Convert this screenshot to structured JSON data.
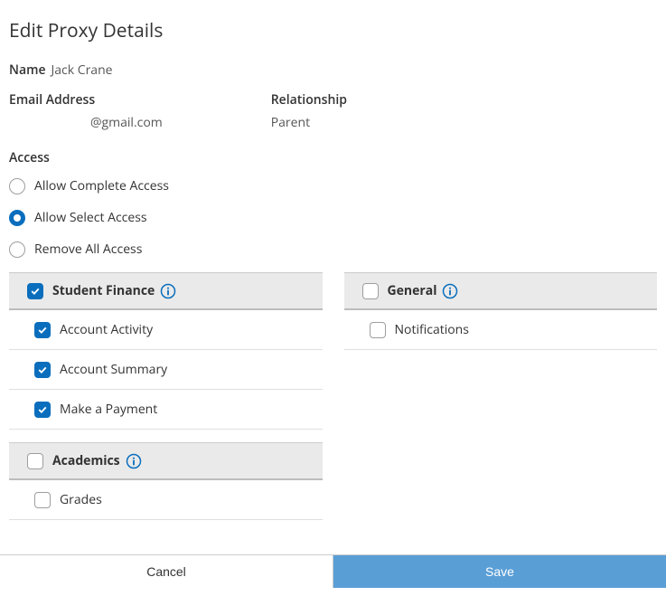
{
  "page": {
    "title": "Edit Proxy Details"
  },
  "labels": {
    "name": "Name",
    "email": "Email Address",
    "relationship": "Relationship",
    "access": "Access"
  },
  "proxy": {
    "name": "Jack Crane",
    "email": "@gmail.com",
    "relationship": "Parent"
  },
  "access_options": {
    "complete": "Allow Complete Access",
    "select": "Allow Select Access",
    "remove": "Remove All Access",
    "selected": "select"
  },
  "groups": {
    "student_finance": {
      "label": "Student Finance",
      "checked": true,
      "items": {
        "account_activity": {
          "label": "Account Activity",
          "checked": true
        },
        "account_summary": {
          "label": "Account Summary",
          "checked": true
        },
        "make_payment": {
          "label": "Make a Payment",
          "checked": true
        }
      }
    },
    "academics": {
      "label": "Academics",
      "checked": false,
      "items": {
        "grades": {
          "label": "Grades",
          "checked": false
        }
      }
    },
    "general": {
      "label": "General",
      "checked": false,
      "items": {
        "notifications": {
          "label": "Notifications",
          "checked": false
        }
      }
    }
  },
  "footer": {
    "cancel": "Cancel",
    "save": "Save"
  }
}
